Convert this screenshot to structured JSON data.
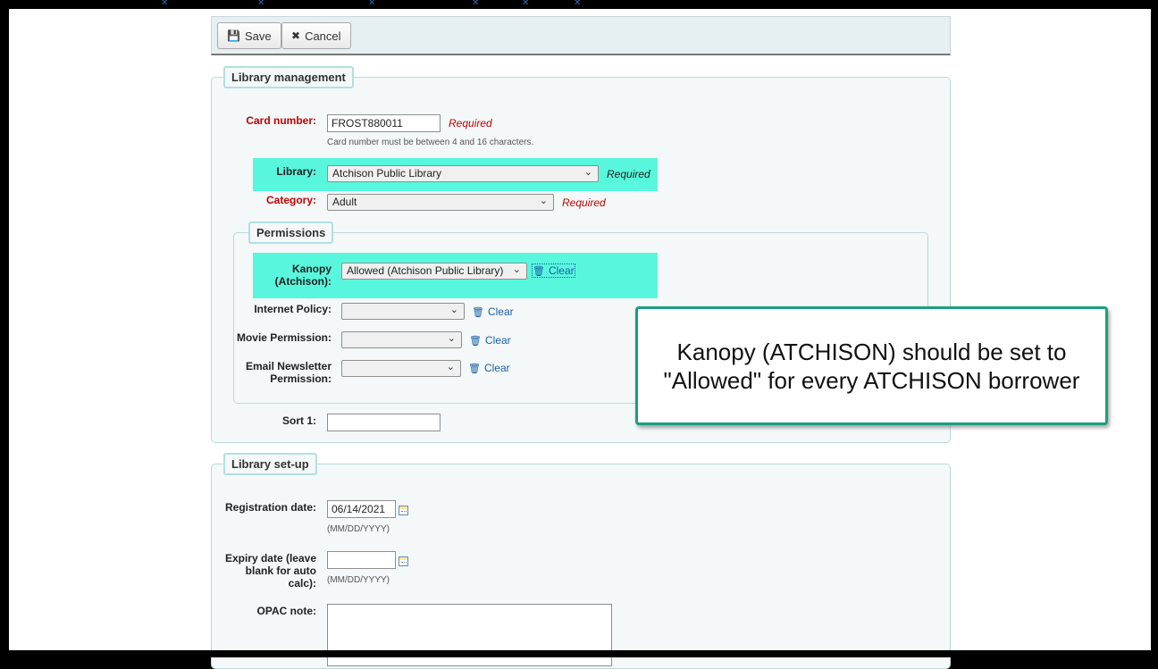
{
  "toolbar": {
    "save_label": "Save",
    "cancel_label": "Cancel"
  },
  "library_management": {
    "legend": "Library management",
    "card_number": {
      "label": "Card number:",
      "value": "FROST880011",
      "required": "Required",
      "hint": "Card number must be between 4 and 16 characters."
    },
    "library": {
      "label": "Library:",
      "value": "Atchison Public Library",
      "required": "Required"
    },
    "category": {
      "label": "Category:",
      "value": "Adult",
      "required": "Required"
    },
    "permissions": {
      "legend": "Permissions",
      "kanopy": {
        "label_line1": "Kanopy",
        "label_line2": "(Atchison):",
        "value": "Allowed (Atchison Public Library)",
        "clear": "Clear"
      },
      "internet_policy": {
        "label": "Internet Policy:",
        "value": "",
        "clear": "Clear"
      },
      "movie_permission": {
        "label": "Movie Permission:",
        "value": "",
        "clear": "Clear"
      },
      "email_newsletter": {
        "label_line1": "Email Newsletter",
        "label_line2": "Permission:",
        "value": "",
        "clear": "Clear"
      }
    },
    "sort1": {
      "label": "Sort 1:",
      "value": ""
    }
  },
  "library_setup": {
    "legend": "Library set-up",
    "registration_date": {
      "label": "Registration date:",
      "value": "06/14/2021",
      "hint": "(MM/DD/YYYY)"
    },
    "expiry_date": {
      "label_line1": "Expiry date (leave",
      "label_line2": "blank for auto",
      "label_line3": "calc):",
      "value": "",
      "hint": "(MM/DD/YYYY)"
    },
    "opac_note": {
      "label": "OPAC note:",
      "value": ""
    }
  },
  "callout": {
    "line1": "Kanopy (ATCHISON) should be set to",
    "line2": "\"Allowed\" for every ATCHISON borrower"
  },
  "colors": {
    "highlight": "#58f7dd",
    "required": "#c40000",
    "callout_border": "#1a9e80",
    "link": "#1a5fa8"
  }
}
